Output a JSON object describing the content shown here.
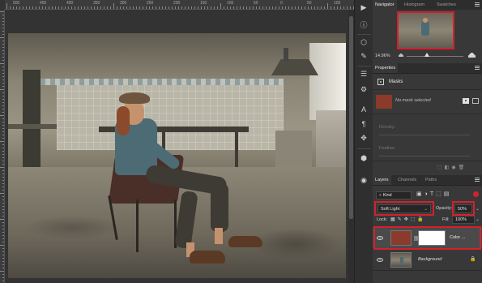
{
  "ruler": {
    "labels": [
      "500",
      "450",
      "400",
      "350",
      "300",
      "250",
      "200",
      "150",
      "100",
      "50",
      "0",
      "50",
      "100"
    ]
  },
  "navigator": {
    "tabs": [
      "Navigator",
      "Histogram",
      "Swatches"
    ],
    "zoom": "14.96%"
  },
  "properties": {
    "title": "Properties",
    "section": "Masks",
    "mask_status": "No mask selected",
    "density_label": "Density:",
    "feather_label": "Feather:"
  },
  "layers": {
    "tabs": [
      "Layers",
      "Channels",
      "Paths"
    ],
    "filter_kind": "Kind",
    "blend_mode": "Soft Light",
    "opacity_label": "Opacity:",
    "opacity_value": "50%",
    "lock_label": "Lock:",
    "fill_label": "Fill:",
    "fill_value": "100%",
    "rows": [
      {
        "name": "Color ...",
        "thumb_color": "#8b3a2b"
      },
      {
        "name": "Background"
      }
    ]
  },
  "colors": {
    "highlight_red": "#d3212c",
    "fill_color_swatch": "#8b3a2b"
  },
  "icons": {
    "strip": [
      "play-icon",
      "info-icon",
      "paint-bucket-icon",
      "brush-settings-icon",
      "adjustments-icon",
      "character-icon",
      "paragraph-icon",
      "clone-source-icon",
      "3d-icon",
      "shapes-icon",
      "layers-comp-icon"
    ]
  }
}
